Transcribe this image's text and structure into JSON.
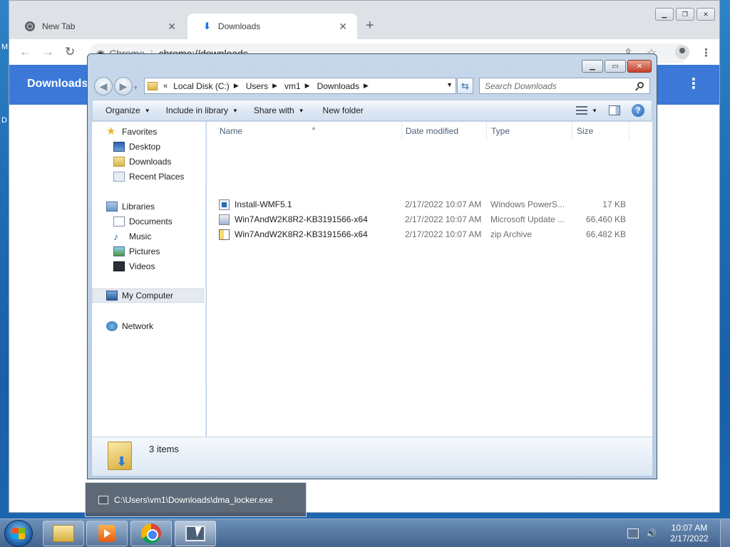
{
  "desktop": {
    "left_label_1": "M",
    "left_label_2": "D"
  },
  "chrome": {
    "tabs": [
      {
        "label": "New Tab",
        "close": "✕"
      },
      {
        "label": "Downloads",
        "close": "✕"
      }
    ],
    "new_tab_symbol": "+",
    "url_site": "Chrome",
    "url_path": "chrome://downloads",
    "page_title": "Downloads",
    "menu_symbol": "⋮"
  },
  "explorer": {
    "address": {
      "chevrons": "«",
      "crumbs": [
        "Local Disk (C:)",
        "Users",
        "vm1",
        "Downloads"
      ]
    },
    "search_placeholder": "Search Downloads",
    "toolbar": {
      "organize": "Organize",
      "include_in_library": "Include in library",
      "share_with": "Share with",
      "new_folder": "New folder"
    },
    "nav": {
      "favorites": "Favorites",
      "desktop": "Desktop",
      "downloads": "Downloads",
      "recent_places": "Recent Places",
      "libraries": "Libraries",
      "documents": "Documents",
      "music": "Music",
      "pictures": "Pictures",
      "videos": "Videos",
      "my_computer": "My Computer",
      "network": "Network"
    },
    "columns": {
      "name": "Name",
      "date": "Date modified",
      "type": "Type",
      "size": "Size"
    },
    "files": [
      {
        "name": "Install-WMF5.1",
        "date": "2/17/2022 10:07 AM",
        "type": "Windows PowerS...",
        "size": "17 KB",
        "icon": "powershell-script-icon"
      },
      {
        "name": "Win7AndW2K8R2-KB3191566-x64",
        "date": "2/17/2022 10:07 AM",
        "type": "Microsoft Update ...",
        "size": "66,460 KB",
        "icon": "update-package-icon"
      },
      {
        "name": "Win7AndW2K8R2-KB3191566-x64",
        "date": "2/17/2022 10:07 AM",
        "type": "zip Archive",
        "size": "66,482 KB",
        "icon": "zip-archive-icon"
      }
    ],
    "status": "3 items"
  },
  "tooltip": {
    "text": "C:\\Users\\vm1\\Downloads\\dma_locker.exe"
  },
  "taskbar": {
    "time": "10:07 AM",
    "date": "2/17/2022"
  }
}
